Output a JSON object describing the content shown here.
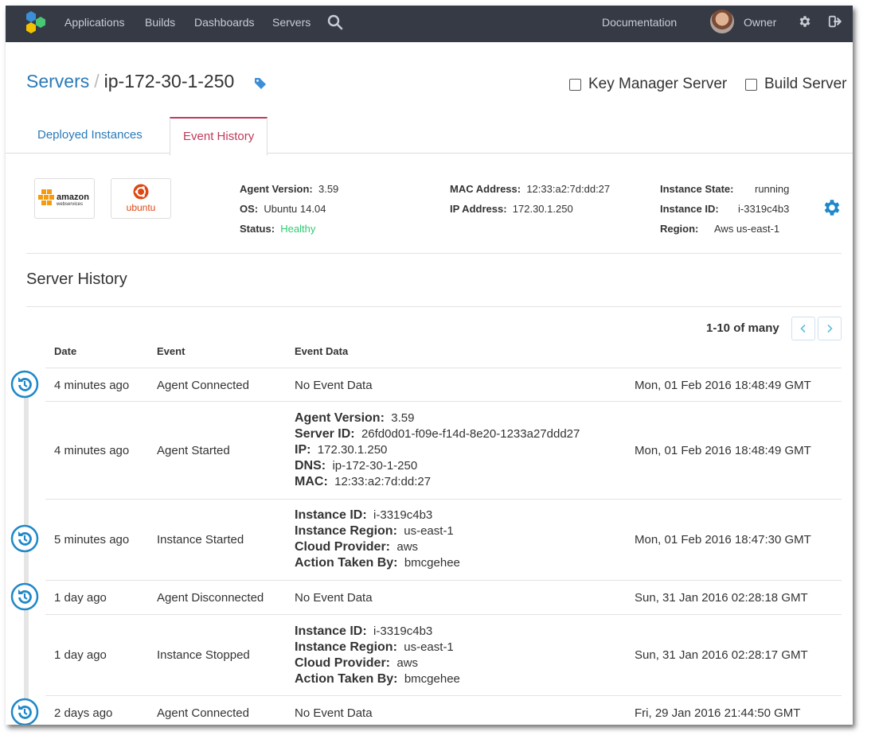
{
  "nav": {
    "items": [
      "Applications",
      "Builds",
      "Dashboards",
      "Servers"
    ],
    "documentation": "Documentation",
    "user": "Owner"
  },
  "header": {
    "breadcrumb_root": "Servers",
    "breadcrumb_sep": "/",
    "server_name": "ip-172-30-1-250",
    "checkbox_key_manager": "Key Manager Server",
    "checkbox_build_server": "Build Server"
  },
  "tabs": [
    "Deployed Instances",
    "Event History"
  ],
  "logos": {
    "aws_top": "amazon",
    "aws_bottom": "webservices",
    "ubuntu": "ubuntu"
  },
  "info": {
    "agent_version_label": "Agent Version:",
    "agent_version": "3.59",
    "os_label": "OS:",
    "os": "Ubuntu 14.04",
    "status_label": "Status:",
    "status": "Healthy",
    "mac_label": "MAC Address:",
    "mac": "12:33:a2:7d:dd:27",
    "ip_label": "IP Address:",
    "ip": "172.30.1.250",
    "state_label": "Instance State:",
    "state": "running",
    "instance_label": "Instance ID:",
    "instance": "i-3319c4b3",
    "region_label": "Region:",
    "region": "Aws us-east-1"
  },
  "history": {
    "title": "Server History",
    "pager": "1-10 of many",
    "columns": [
      "Date",
      "Event",
      "Event Data"
    ],
    "rows": [
      {
        "date": "4 minutes ago",
        "event": "Agent Connected",
        "data": "No Event Data",
        "timestamp": "Mon, 01 Feb 2016 18:48:49 GMT"
      },
      {
        "date": "4 minutes ago",
        "event": "Agent Started",
        "kv": [
          [
            "Agent Version:",
            "3.59"
          ],
          [
            "Server ID:",
            "26fd0d01-f09e-f14d-8e20-1233a27ddd27"
          ],
          [
            "IP:",
            "172.30.1.250"
          ],
          [
            "DNS:",
            "ip-172-30-1-250"
          ],
          [
            "MAC:",
            "12:33:a2:7d:dd:27"
          ]
        ],
        "timestamp": "Mon, 01 Feb 2016 18:48:49 GMT"
      },
      {
        "date": "5 minutes ago",
        "event": "Instance Started",
        "kv": [
          [
            "Instance ID:",
            "i-3319c4b3"
          ],
          [
            "Instance Region:",
            "us-east-1"
          ],
          [
            "Cloud Provider:",
            "aws"
          ],
          [
            "Action Taken By:",
            "bmcgehee"
          ]
        ],
        "timestamp": "Mon, 01 Feb 2016 18:47:30 GMT"
      },
      {
        "date": "1 day ago",
        "event": "Agent Disconnected",
        "data": "No Event Data",
        "timestamp": "Sun, 31 Jan 2016 02:28:18 GMT"
      },
      {
        "date": "1 day ago",
        "event": "Instance Stopped",
        "kv": [
          [
            "Instance ID:",
            "i-3319c4b3"
          ],
          [
            "Instance Region:",
            "us-east-1"
          ],
          [
            "Cloud Provider:",
            "aws"
          ],
          [
            "Action Taken By:",
            "bmcgehee"
          ]
        ],
        "timestamp": "Sun, 31 Jan 2016 02:28:17 GMT"
      },
      {
        "date": "2 days ago",
        "event": "Agent Connected",
        "data": "No Event Data",
        "timestamp": "Fri, 29 Jan 2016 21:44:50 GMT"
      }
    ]
  },
  "colors": {
    "nav_bg": "#353a45",
    "link": "#2a7ab8",
    "active_tab": "#c0395a",
    "healthy": "#2ecc71",
    "timeline_icon": "#1e88c9"
  }
}
